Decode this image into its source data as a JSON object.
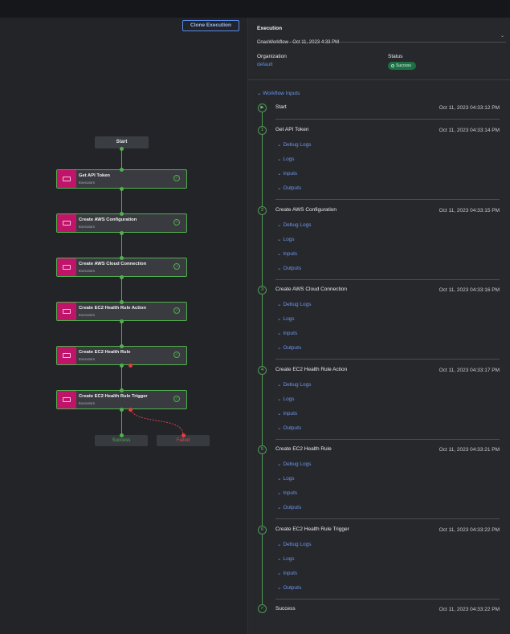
{
  "toolbar": {
    "clone_label": "Clone Execution"
  },
  "colors": {
    "accent": "#5b8def",
    "success": "#52b04f",
    "failed": "#e0403f",
    "step_tag": "#c0136a"
  },
  "graph": {
    "start_label": "Start",
    "steps": [
      {
        "title": "Get API Token",
        "subtitle": "Executors"
      },
      {
        "title": "Create AWS Configuration",
        "subtitle": "Executors"
      },
      {
        "title": "Create AWS Cloud Connection",
        "subtitle": "Executors"
      },
      {
        "title": "Create EC2 Health Rule Action",
        "subtitle": "Executors"
      },
      {
        "title": "Create EC2 Health Rule",
        "subtitle": "Executors"
      },
      {
        "title": "Create EC2 Health Rule Trigger",
        "subtitle": "Executors"
      }
    ],
    "success_label": "Success",
    "failed_label": "Failed"
  },
  "panel": {
    "execution_label": "Execution",
    "execution_value": "CnaoWorkflow - Oct 11, 2023 4:33 PM",
    "organization_label": "Organization",
    "organization_value": "default",
    "status_label": "Status",
    "status_value": "Success",
    "workflow_inputs_label": "Workflow Inputs",
    "start": {
      "marker": "▶",
      "title": "Start",
      "time": "Oct 11, 2023 04:33:12 PM"
    },
    "steps": [
      {
        "num": "1",
        "title": "Get API Token",
        "time": "Oct 11, 2023 04:33:14 PM",
        "subs": [
          "Debug Logs",
          "Logs",
          "Inputs",
          "Outputs"
        ]
      },
      {
        "num": "2",
        "title": "Create AWS Configuration",
        "time": "Oct 11, 2023 04:33:15 PM",
        "subs": [
          "Debug Logs",
          "Logs",
          "Inputs",
          "Outputs"
        ]
      },
      {
        "num": "3",
        "title": "Create AWS Cloud Connection",
        "time": "Oct 11, 2023 04:33:16 PM",
        "subs": [
          "Debug Logs",
          "Logs",
          "Inputs",
          "Outputs"
        ]
      },
      {
        "num": "4",
        "title": "Create EC2 Health Rule Action",
        "time": "Oct 11, 2023 04:33:17 PM",
        "subs": [
          "Debug Logs",
          "Logs",
          "Inputs",
          "Outputs"
        ]
      },
      {
        "num": "5",
        "title": "Create EC2 Health Rule",
        "time": "Oct 11, 2023 04:33:21 PM",
        "subs": [
          "Debug Logs",
          "Logs",
          "Inputs",
          "Outputs"
        ]
      },
      {
        "num": "6",
        "title": "Create EC2 Health Rule Trigger",
        "time": "Oct 11, 2023 04:33:22 PM",
        "subs": [
          "Debug Logs",
          "Logs",
          "Inputs",
          "Outputs"
        ]
      }
    ],
    "end": {
      "marker": "✓",
      "title": "Success",
      "time": "Oct 11, 2023 04:33:22 PM"
    }
  }
}
